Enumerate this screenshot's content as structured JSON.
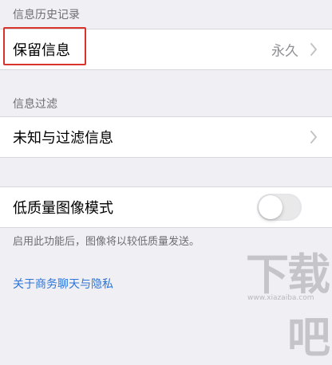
{
  "sections": {
    "history_header": "信息历史记录",
    "filter_header": "信息过滤"
  },
  "rows": {
    "keep_messages": {
      "label": "保留信息",
      "value": "永久"
    },
    "unknown_filter": {
      "label": "未知与过滤信息"
    },
    "low_quality": {
      "label": "低质量图像模式",
      "enabled": false
    }
  },
  "footer_note": "启用此功能后，图像将以较低质量发送。",
  "link": "关于商务聊天与隐私",
  "watermark": {
    "text": "下载吧",
    "url": "www.xiazaiba.com"
  },
  "colors": {
    "highlight": "#d8342b",
    "link": "#2c74d8",
    "background": "#efeff4"
  }
}
